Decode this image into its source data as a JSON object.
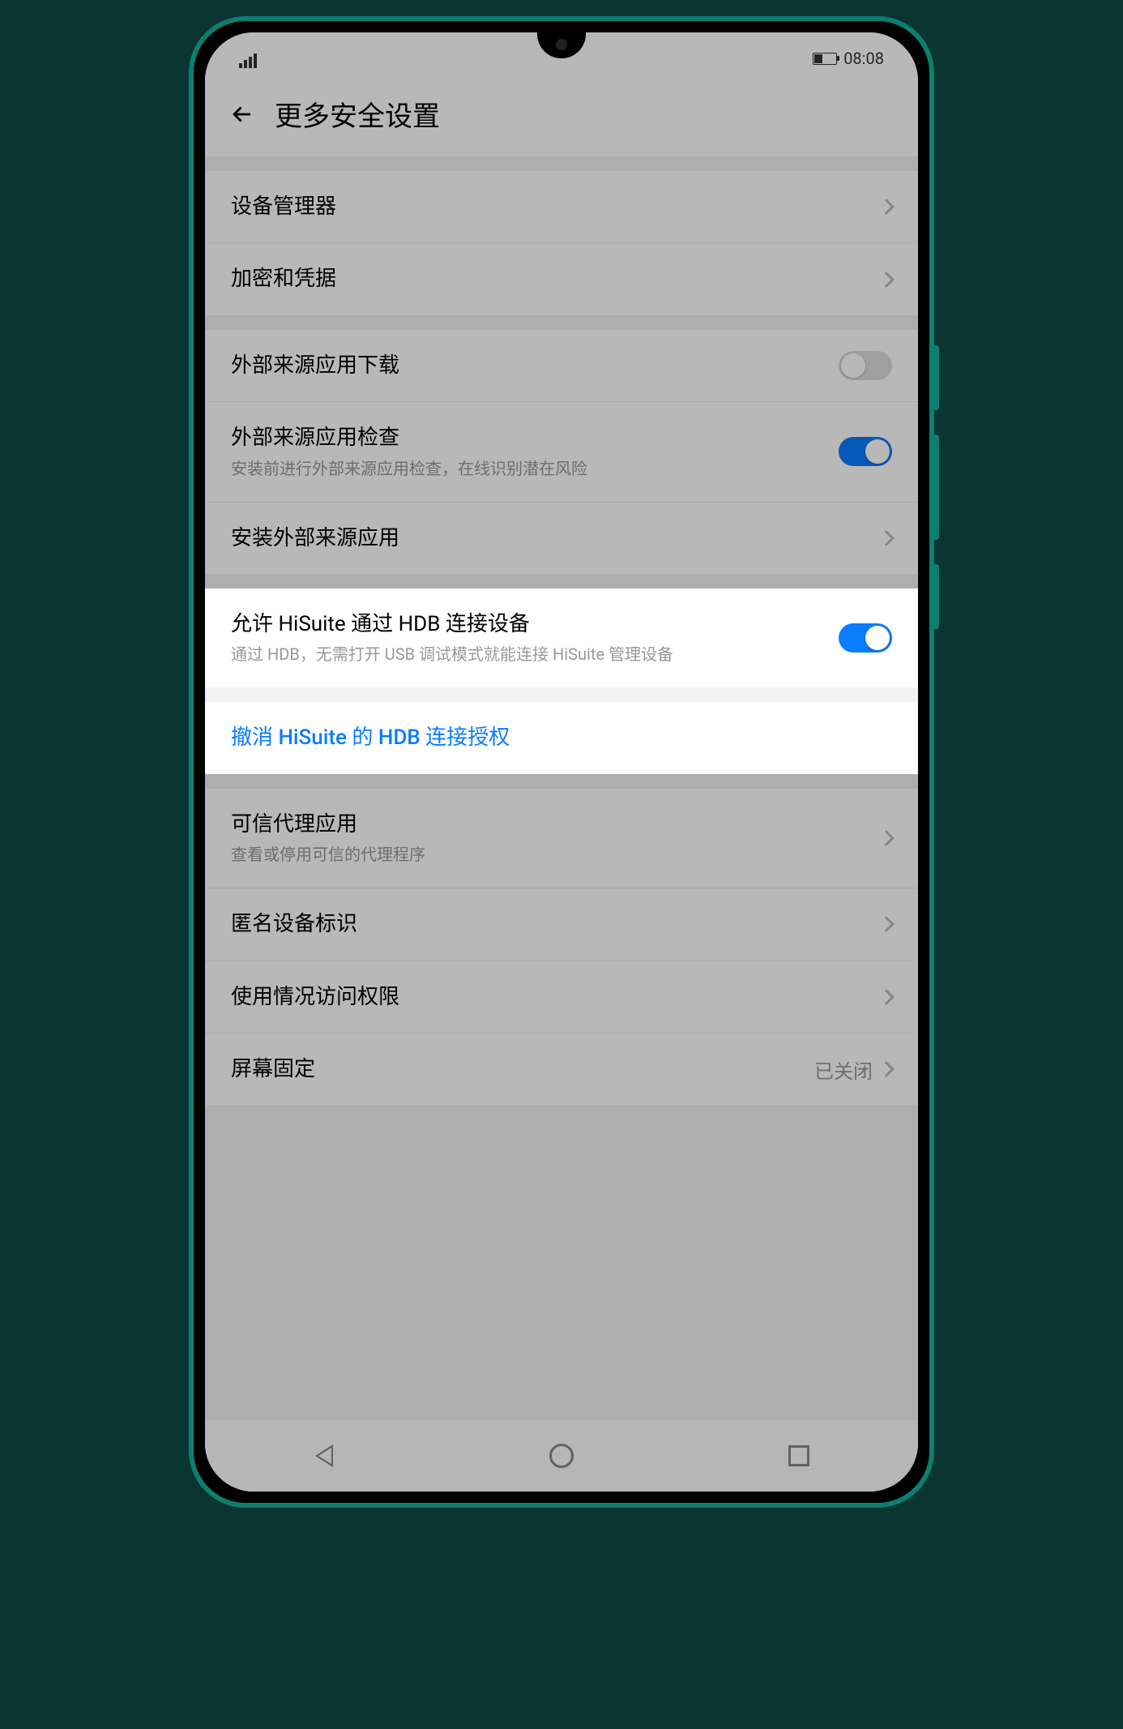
{
  "status_bar": {
    "time": "08:08"
  },
  "header": {
    "title": "更多安全设置"
  },
  "rows": {
    "device_admin": {
      "title": "设备管理器"
    },
    "encryption": {
      "title": "加密和凭据"
    },
    "ext_download": {
      "title": "外部来源应用下载"
    },
    "ext_check": {
      "title": "外部来源应用检查",
      "sub": "安装前进行外部来源应用检查，在线识别潜在风险"
    },
    "install_ext": {
      "title": "安装外部来源应用"
    },
    "hisuite_allow": {
      "title": "允许 HiSuite 通过 HDB 连接设备",
      "sub": "通过 HDB，无需打开 USB 调试模式就能连接 HiSuite 管理设备"
    },
    "hisuite_revoke": {
      "title": "撤消 HiSuite 的 HDB 连接授权"
    },
    "trusted_agent": {
      "title": "可信代理应用",
      "sub": "查看或停用可信的代理程序"
    },
    "anon_id": {
      "title": "匿名设备标识"
    },
    "usage_access": {
      "title": "使用情况访问权限"
    },
    "screen_pin": {
      "title": "屏幕固定",
      "value": "已关闭"
    }
  }
}
